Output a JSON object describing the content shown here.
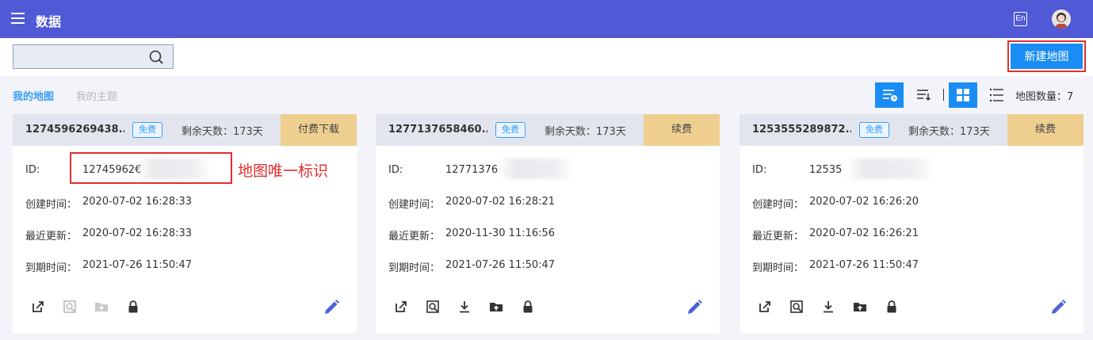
{
  "header": {
    "title": "数据",
    "lang": "En"
  },
  "toolbar": {
    "search_placeholder": "",
    "new_map_label": "新建地图"
  },
  "tabs": {
    "active": "我的地图",
    "inactive": "我的主题"
  },
  "map_count": "地图数量：7",
  "labels": {
    "id": "ID:",
    "created": "创建时间：",
    "updated": "最近更新：",
    "expires": "到期时间："
  },
  "cards": [
    {
      "title": "1274596269438...",
      "badge": "免费",
      "days": "剩余天数：173天",
      "action": "付费下载",
      "id_value": "12745962€",
      "created": "2020-07-02 16:28:33",
      "updated": "2020-07-02 16:28:33",
      "expires": "2021-07-26 11:50:47"
    },
    {
      "title": "1277137658460...",
      "badge": "免费",
      "days": "剩余天数：173天",
      "action": "续费",
      "id_value": "12771376",
      "created": "2020-07-02 16:28:21",
      "updated": "2020-11-30 11:16:56",
      "expires": "2021-07-26 11:50:47"
    },
    {
      "title": "1253555289872...",
      "badge": "免费",
      "days": "剩余天数：173天",
      "action": "续费",
      "id_value": "12535",
      "created": "2020-07-02 16:26:20",
      "updated": "2020-07-02 16:26:21",
      "expires": "2021-07-26 11:50:47"
    }
  ],
  "annotation": "地图唯一标识",
  "colors": {
    "header": "#5059d6",
    "primary": "#1a8df4",
    "highlight": "#e02f2f",
    "action_bg": "#efcf90",
    "edit": "#4d63d6"
  }
}
